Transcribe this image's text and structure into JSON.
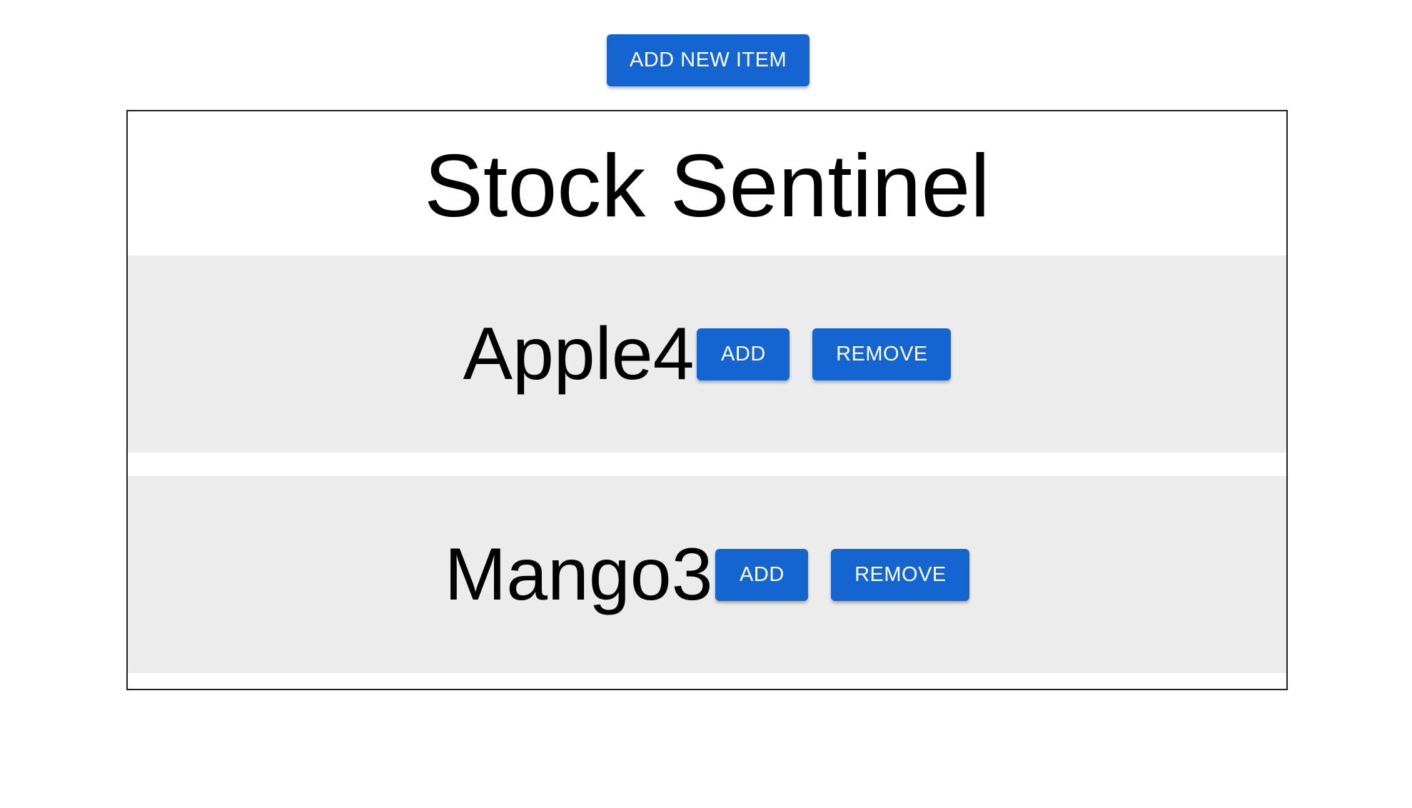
{
  "toolbar": {
    "add_new_item_label": "ADD NEW ITEM"
  },
  "panel": {
    "title": "Stock Sentinel"
  },
  "items": [
    {
      "name": "Apple",
      "quantity": "4",
      "add_label": "ADD",
      "remove_label": "REMOVE"
    },
    {
      "name": "Mango",
      "quantity": "3",
      "add_label": "ADD",
      "remove_label": "REMOVE"
    }
  ],
  "colors": {
    "button_primary": "#1565d0",
    "row_background": "#ececec"
  }
}
